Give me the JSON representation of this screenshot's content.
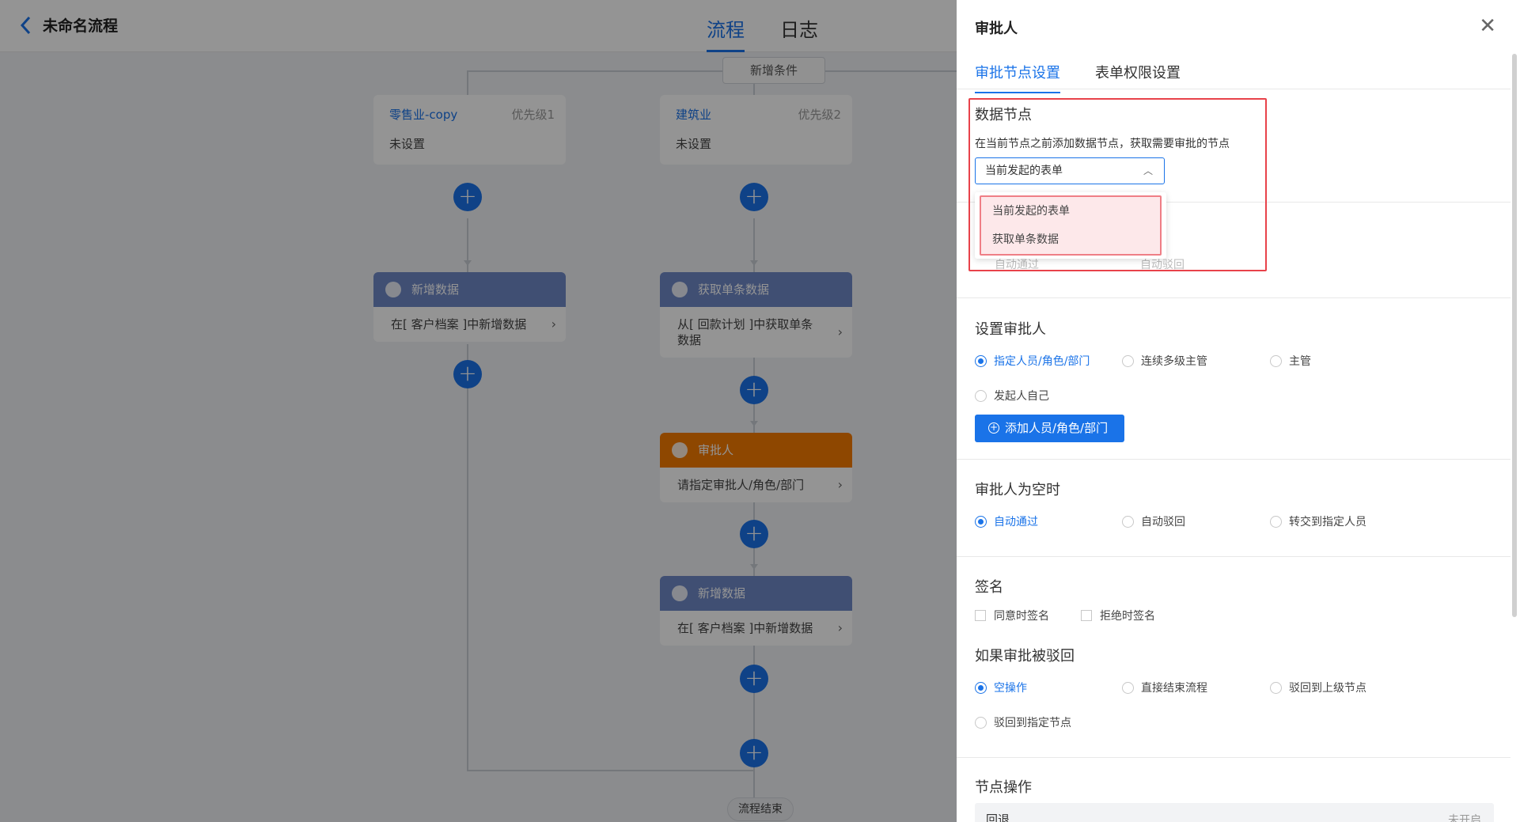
{
  "header": {
    "title": "未命名流程",
    "tabs": [
      {
        "label": "流程",
        "active": true
      },
      {
        "label": "日志",
        "active": false
      }
    ]
  },
  "canvas": {
    "add_condition": "新增条件",
    "conditions": [
      {
        "name": "零售业-copy",
        "priority": "优先级1",
        "value": "未设置"
      },
      {
        "name": "建筑业",
        "priority": "优先级2",
        "value": "未设置"
      }
    ],
    "nodes": [
      {
        "title": "新增数据",
        "body": "在[ 客户档案 ]中新增数据",
        "color": "#6e88c7"
      },
      {
        "title": "获取单条数据",
        "body": "从[ 回款计划 ]中获取单条数据",
        "color": "#6e88c7"
      },
      {
        "title": "审批人",
        "body": "请指定审批人/角色/部门",
        "color": "#f47b00"
      },
      {
        "title": "新增数据",
        "body": "在[ 客户档案 ]中新增数据",
        "color": "#6e88c7"
      }
    ],
    "end_label": "流程结束"
  },
  "panel": {
    "title": "审批人",
    "tabs": [
      {
        "label": "审批节点设置",
        "active": true
      },
      {
        "label": "表单权限设置",
        "active": false
      }
    ],
    "data_node": {
      "title": "数据节点",
      "hint": "在当前节点之前添加数据节点，获取需要审批的节点",
      "selected": "当前发起的表单",
      "options": [
        "当前发起的表单",
        "获取单条数据"
      ]
    },
    "hidden_row": {
      "left": "自动通过",
      "right": "自动驳回"
    },
    "approver": {
      "title": "设置审批人",
      "options": [
        "指定人员/角色/部门",
        "连续多级主管",
        "主管",
        "发起人自己"
      ],
      "selected": "指定人员/角色/部门",
      "add_button": "添加人员/角色/部门"
    },
    "empty_approver": {
      "title": "审批人为空时",
      "options": [
        "自动通过",
        "自动驳回",
        "转交到指定人员"
      ],
      "selected": "自动通过"
    },
    "signature": {
      "title": "签名",
      "options": [
        "同意时签名",
        "拒绝时签名"
      ]
    },
    "rejected": {
      "title": "如果审批被驳回",
      "options": [
        "空操作",
        "直接结束流程",
        "驳回到上级节点",
        "驳回到指定节点"
      ],
      "selected": "空操作"
    },
    "node_ops": {
      "title": "节点操作",
      "row_label": "回退",
      "row_status": "未开启"
    }
  },
  "colors": {
    "accent": "#1a73e8",
    "approver_node": "#f47b00",
    "data_node": "#6e88c7",
    "highlight": "#e8424a"
  }
}
